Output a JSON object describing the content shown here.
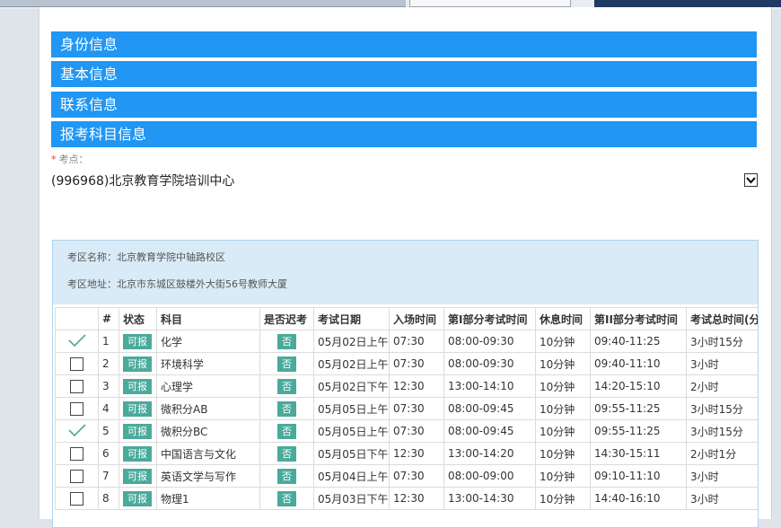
{
  "sections": {
    "identity": "身份信息",
    "basic": "基本信息",
    "contact": "联系信息",
    "subjects": "报考科目信息"
  },
  "exam_site": {
    "label": "考点：",
    "required_mark": "*",
    "selected": "(996968)北京教育学院培训中心"
  },
  "exam_area": {
    "name_line": "考区名称：北京教育学院中轴路校区",
    "address_line": "考区地址：北京市东城区鼓楼外大街56号教师大厦"
  },
  "table": {
    "headers": [
      "",
      "#",
      "状态",
      "科目",
      "是否迟考",
      "考试日期",
      "入场时间",
      "第I部分考试时间",
      "休息时间",
      "第II部分考试时间",
      "考试总时间(分"
    ],
    "rows": [
      {
        "checked": true,
        "no": "1",
        "status": "可报",
        "subject": "化学",
        "late": "否",
        "date": "05月02日上午",
        "entry": "07:30",
        "part1": "08:00-09:30",
        "rest": "10分钟",
        "part2": "09:40-11:25",
        "total": "3小时15分"
      },
      {
        "checked": false,
        "no": "2",
        "status": "可报",
        "subject": "环境科学",
        "late": "否",
        "date": "05月02日上午",
        "entry": "07:30",
        "part1": "08:00-09:30",
        "rest": "10分钟",
        "part2": "09:40-11:10",
        "total": "3小时"
      },
      {
        "checked": false,
        "no": "3",
        "status": "可报",
        "subject": "心理学",
        "late": "否",
        "date": "05月02日下午",
        "entry": "12:30",
        "part1": "13:00-14:10",
        "rest": "10分钟",
        "part2": "14:20-15:10",
        "total": "2小时"
      },
      {
        "checked": false,
        "no": "4",
        "status": "可报",
        "subject": "微积分AB",
        "late": "否",
        "date": "05月05日上午",
        "entry": "07:30",
        "part1": "08:00-09:45",
        "rest": "10分钟",
        "part2": "09:55-11:25",
        "total": "3小时15分"
      },
      {
        "checked": true,
        "no": "5",
        "status": "可报",
        "subject": "微积分BC",
        "late": "否",
        "date": "05月05日上午",
        "entry": "07:30",
        "part1": "08:00-09:45",
        "rest": "10分钟",
        "part2": "09:55-11:25",
        "total": "3小时15分"
      },
      {
        "checked": false,
        "no": "6",
        "status": "可报",
        "subject": "中国语言与文化",
        "late": "否",
        "date": "05月05日下午",
        "entry": "12:30",
        "part1": "13:00-14:20",
        "rest": "10分钟",
        "part2": "14:30-15:11",
        "total": "2小时1分"
      },
      {
        "checked": false,
        "no": "7",
        "status": "可报",
        "subject": "英语文学与写作",
        "late": "否",
        "date": "05月04日上午",
        "entry": "07:30",
        "part1": "08:00-09:00",
        "rest": "10分钟",
        "part2": "09:10-11:10",
        "total": "3小时"
      },
      {
        "checked": false,
        "no": "8",
        "status": "可报",
        "subject": "物理1",
        "late": "否",
        "date": "05月03日下午",
        "entry": "12:30",
        "part1": "13:00-14:30",
        "rest": "10分钟",
        "part2": "14:40-16:10",
        "total": "3小时"
      }
    ]
  },
  "colors": {
    "section_bg": "#2196f3",
    "badge": "#4aaa9b",
    "checkmark": "#4aaa9b",
    "info_bg": "#d9ebf7"
  }
}
